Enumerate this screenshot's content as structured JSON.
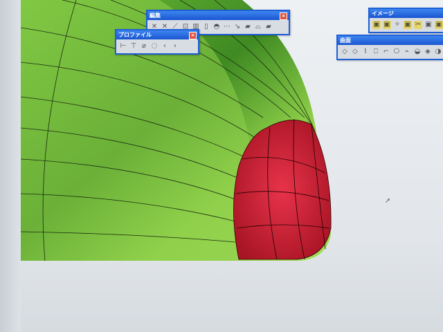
{
  "toolbars": {
    "edit": {
      "title": "編集",
      "icons": [
        "✕",
        "✕",
        "⟋",
        "⊡",
        "▥",
        "▯",
        "◓",
        "⋯",
        "↘",
        "▰",
        "⌓",
        "▰"
      ]
    },
    "profile": {
      "title": "プロファイル",
      "icons": [
        "⊢",
        "⊤",
        "⌀",
        "◌",
        "‹",
        "›"
      ]
    },
    "image": {
      "title": "イメージ",
      "icons": [
        "▣",
        "▣",
        "✧",
        "▣",
        "✂",
        "▣",
        "▣"
      ]
    },
    "surface": {
      "title": "曲面",
      "icons": [
        "◇",
        "◇",
        "⌇",
        "⎕",
        "⌐",
        "⎔",
        "⌁",
        "◒",
        "◈",
        "◑"
      ]
    }
  },
  "colors": {
    "surface_green": "#8fd04a",
    "fillet_red": "#d8283a",
    "title_blue": "#1e5fd6"
  },
  "close_glyph": "×"
}
